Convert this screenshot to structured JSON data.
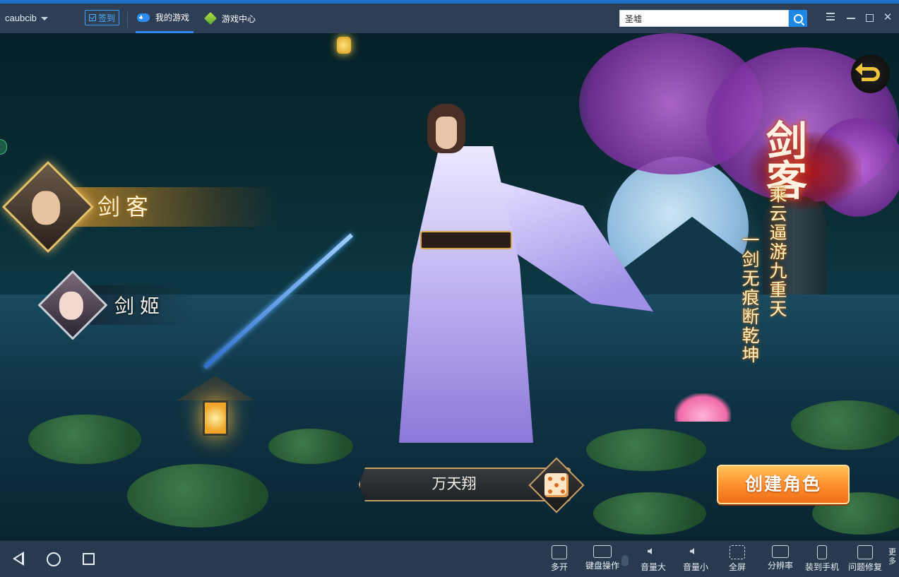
{
  "window": {
    "username": "caubcib",
    "checkin_label": "签到",
    "tabs": [
      {
        "label": "我的游戏",
        "active": true
      },
      {
        "label": "游戏中心",
        "active": false
      }
    ],
    "search": {
      "value": "圣墟",
      "placeholder": ""
    },
    "colors": {
      "accent": "#1f72c9",
      "titlebar": "#2e3f55",
      "create_button": "#ff9530"
    }
  },
  "game": {
    "classes": [
      {
        "name": "剑客",
        "selected": true
      },
      {
        "name": "剑姬",
        "selected": false
      }
    ],
    "selected_class_title": "剑客",
    "poem_lines": [
      "乘云逼游九重天",
      "一剑无痕断乾坤"
    ],
    "character_name": "万天翔",
    "create_button_label": "创建角色"
  },
  "bottombar": {
    "tools": [
      {
        "label": "多开",
        "icon": "multi-window-icon"
      },
      {
        "label": "键盘操作",
        "icon": "keyboard-icon"
      },
      {
        "label": "音量大",
        "icon": "volume-up-icon"
      },
      {
        "label": "音量小",
        "icon": "volume-down-icon"
      },
      {
        "label": "全屏",
        "icon": "fullscreen-icon"
      },
      {
        "label": "分辨率",
        "icon": "resolution-icon"
      },
      {
        "label": "装到手机",
        "icon": "phone-icon"
      },
      {
        "label": "问题修复",
        "icon": "repair-icon"
      }
    ],
    "more_label": "更多"
  }
}
